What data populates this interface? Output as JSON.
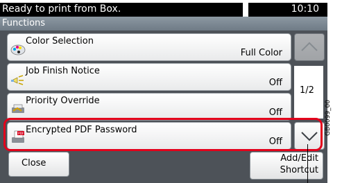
{
  "status": {
    "message": "Ready to print from Box.",
    "time": "10:10"
  },
  "title": "Functions",
  "items": [
    {
      "label": "Color Selection",
      "value": "Full Color",
      "icon": "color-selection-icon"
    },
    {
      "label": "Job Finish Notice",
      "value": "Off",
      "icon": "job-finish-notice-icon"
    },
    {
      "label": "Priority Override",
      "value": "Off",
      "icon": "priority-override-icon"
    },
    {
      "label": "Encrypted PDF Password",
      "value": "Off",
      "icon": "encrypted-pdf-icon"
    }
  ],
  "pagination": {
    "indicator": "1/2"
  },
  "buttons": {
    "close": "Close",
    "add_edit_line1": "Add/Edit",
    "add_edit_line2": "Shortcut"
  },
  "side_code": "GB0099_00",
  "colors": {
    "highlight": "#e3001b",
    "panel": "#4d5258"
  }
}
